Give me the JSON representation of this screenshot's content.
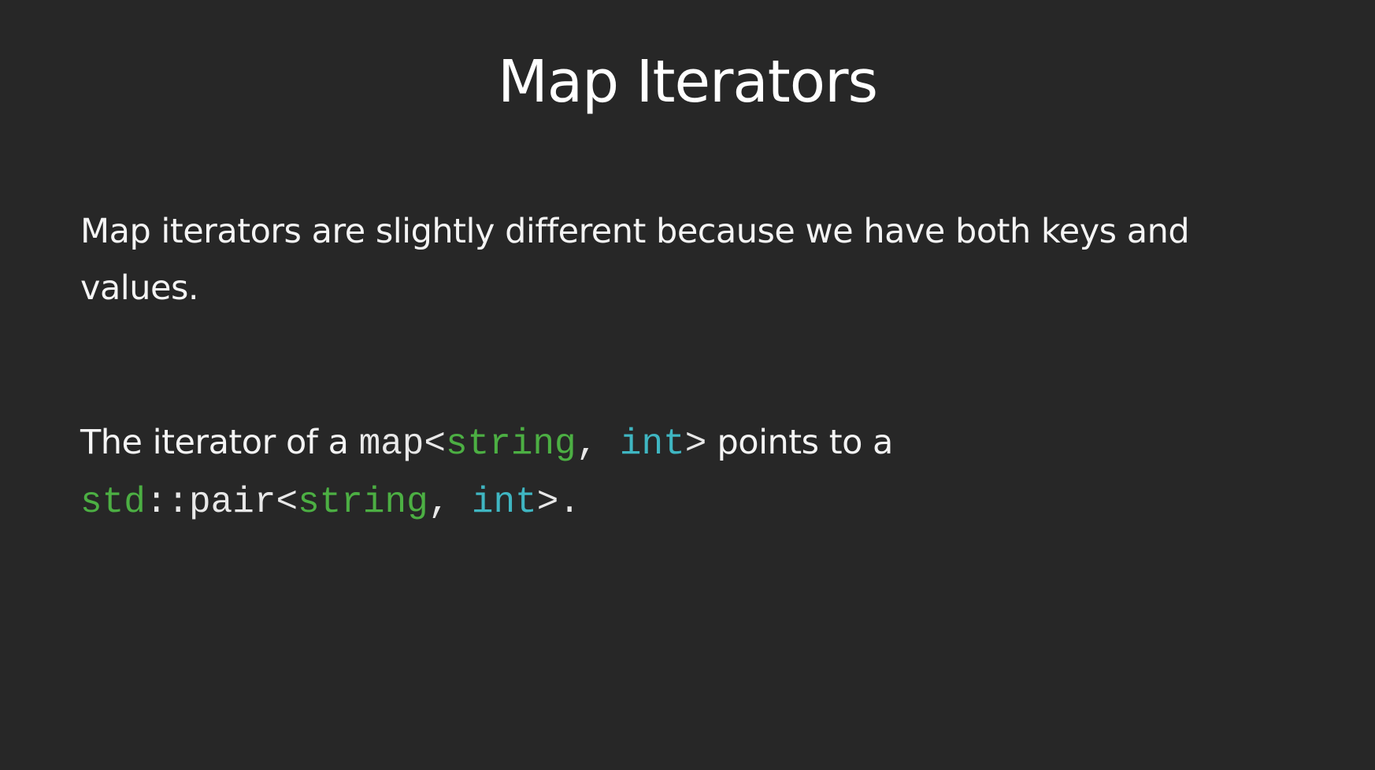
{
  "slide": {
    "title": "Map Iterators",
    "paragraph1": "Map iterators are slightly different because we have both keys and values.",
    "paragraph2": {
      "prefix": "The iterator of a ",
      "code1": {
        "map_open": "map<",
        "string": "string",
        "comma": ", ",
        "int": "int",
        "close": ">"
      },
      "middle": " points to a ",
      "code2": {
        "std": "std",
        "pair_open": "::pair<",
        "string": "string",
        "comma": ", ",
        "int": "int",
        "close": ">"
      },
      "suffix": "."
    },
    "colors": {
      "background": "#272727",
      "text": "#f4f4f4",
      "code_type_green": "#4caf43",
      "code_type_cyan": "#3fb6c2"
    }
  }
}
